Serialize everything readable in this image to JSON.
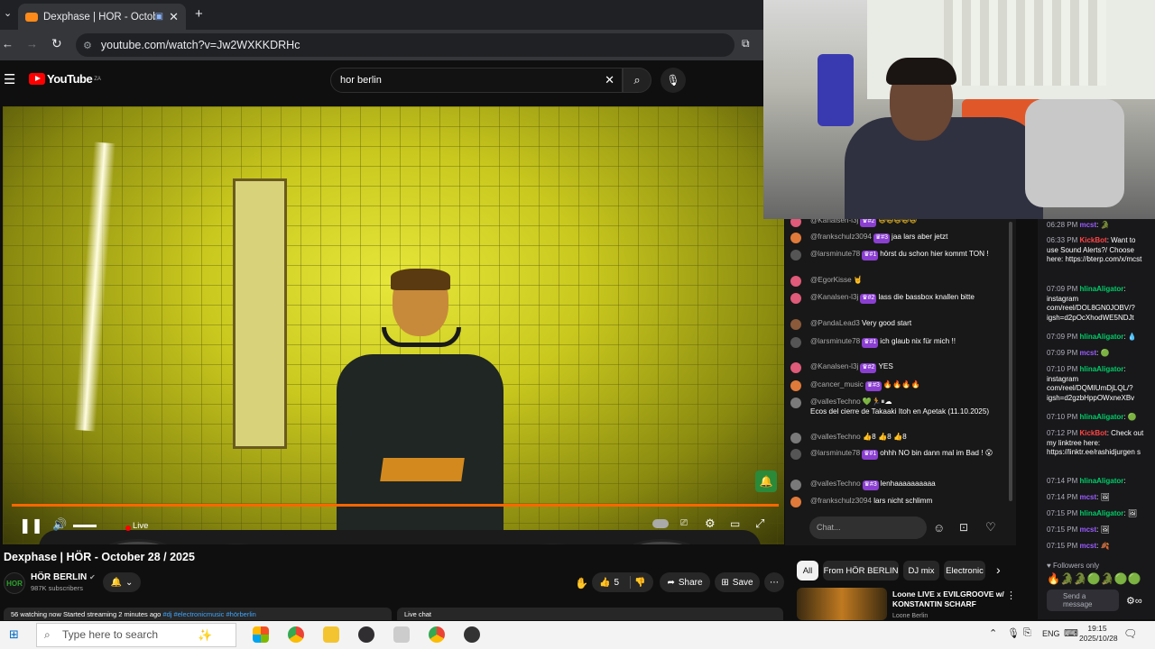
{
  "browser": {
    "tab_title": "Dexphase | HÖR - October",
    "url": "youtube.com/watch?v=Jw2WXKKDRHc"
  },
  "youtube": {
    "logo": "YouTube",
    "region": "ZA",
    "search_value": "hor berlin",
    "video": {
      "live_label": "Live",
      "title": "Dexphase | HÖR - October 28 / 2025",
      "channel": "HÖR BERLIN",
      "channel_avatar": "HOR",
      "subscribers": "987K subscribers",
      "likes": "5",
      "share": "Share",
      "save": "Save",
      "watching": "56 watching now  Started streaming 2 minutes ago",
      "hashtags": "#dj #electronicmusic #hörberlin",
      "live_chat": "Live chat"
    },
    "chat": {
      "messages": [
        {
          "user": "@Kanalsen-l3j",
          "badge": "#2",
          "text": ""
        },
        {
          "user": "@frankschulz3094",
          "badge": "#3",
          "text": "jaa lars aber jetzt"
        },
        {
          "user": "@larsminute78",
          "badge": "#1",
          "text": "hörst du schon hier kommt TON !"
        },
        {
          "user": "@EgorKisse",
          "badge": "",
          "text": "🤘"
        },
        {
          "user": "@Kanalsen-l3j",
          "badge": "#2",
          "text": "lass die bassbox knallen bitte"
        },
        {
          "user": "@PandaLead3",
          "badge": "",
          "text": "Very good start"
        },
        {
          "user": "@larsminute78",
          "badge": "#1",
          "text": "ich glaub nix für mich !!"
        },
        {
          "user": "@Kanalsen-l3j",
          "badge": "#2",
          "text": "YES"
        },
        {
          "user": "@cancer_music",
          "badge": "#3",
          "text": "🔥🔥🔥🔥"
        },
        {
          "user": "@vallesTechno",
          "badge": "",
          "text": "Ecos del cierre de Takaaki Itoh en Apetak (11.10.2025)"
        },
        {
          "user": "@vallesTechno",
          "badge": "",
          "text": "👍8 👍8 👍8"
        },
        {
          "user": "@larsminute78",
          "badge": "#1",
          "text": "ohhh NO bin dann mal im Bad ! 😮"
        },
        {
          "user": "@vallesTechno",
          "badge": "#3",
          "text": "lenhaaaaaaaaaa"
        },
        {
          "user": "@frankschulz3094",
          "badge": "",
          "text": "lars nicht schlimm"
        }
      ],
      "input_placeholder": "Chat..."
    },
    "chips": [
      "All",
      "From HÖR BERLIN",
      "DJ mix",
      "Electronic"
    ],
    "recommended": {
      "title": "Loone LIVE x EVILGROOVE w/ KONSTANTIN SCHARF",
      "channel": "Loone Berlin"
    }
  },
  "twitch_chat": {
    "messages": [
      {
        "time": "06:28 PM",
        "name": "mcst",
        "text": ""
      },
      {
        "time": "06:33 PM",
        "name": "KickBot",
        "text": "Want to use Sound Alerts?/ Choose here: https://bterp.com/x/mcst"
      },
      {
        "time": "07:09 PM",
        "name": "hlinaAligator",
        "text": "instagram com/reel/DOL8GN0JOBV/?igsh=d2pOcXhodWE5NDJt"
      },
      {
        "time": "07:09 PM",
        "name": "hlinaAligator",
        "text": ""
      },
      {
        "time": "07:09 PM",
        "name": "mcst",
        "text": ""
      },
      {
        "time": "07:10 PM",
        "name": "hlinaAligator",
        "text": "instagram com/reel/DQMIUmDjLQL/?igsh=d2gzbHppOWxneXBv"
      },
      {
        "time": "07:10 PM",
        "name": "hlinaAligator",
        "text": ""
      },
      {
        "time": "07:12 PM",
        "name": "KickBot",
        "text": "Check out my linktree here: https://linktr.ee/rashidjurgen s"
      },
      {
        "time": "07:14 PM",
        "name": "hlinaAligator",
        "text": ""
      },
      {
        "time": "07:14 PM",
        "name": "mcst",
        "text": ""
      },
      {
        "time": "07:15 PM",
        "name": "hlinaAligator",
        "text": ""
      },
      {
        "time": "07:15 PM",
        "name": "mcst",
        "text": ""
      },
      {
        "time": "07:15 PM",
        "name": "mcst",
        "text": ""
      }
    ],
    "followers_only": "Followers only",
    "send_message": "Send a message"
  },
  "taskbar": {
    "search_placeholder": "Type here to search",
    "lang": "ENG",
    "time": "19:15",
    "date": "2025/10/28"
  },
  "colors": {
    "accent_red": "#ff0000",
    "progress": "#ff6600",
    "kick_green": "#53fc18"
  }
}
